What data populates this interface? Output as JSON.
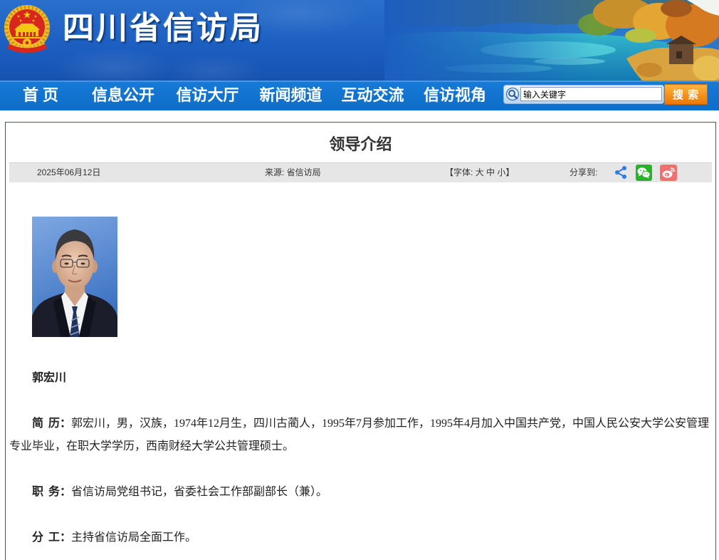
{
  "site": {
    "title": "四川省信访局"
  },
  "nav": {
    "items": [
      {
        "label": "首 页"
      },
      {
        "label": "信息公开"
      },
      {
        "label": "信访大厅"
      },
      {
        "label": "新闻频道"
      },
      {
        "label": "互动交流"
      },
      {
        "label": "信访视角"
      }
    ]
  },
  "search": {
    "value": "输入关键字",
    "button_label": "搜 索",
    "icon": "search-icon"
  },
  "article": {
    "title": "领导介绍",
    "date": "2025年06月12日",
    "source": "来源: 省信访局",
    "font_control": {
      "prefix": "【字体:",
      "sizes": [
        "大",
        "中",
        "小"
      ],
      "suffix": "】"
    },
    "share_label": "分享到:",
    "share_icons": [
      "share-icon",
      "wechat-icon",
      "weibo-icon"
    ],
    "name": "郭宏川",
    "sections": [
      {
        "label": "简 历：",
        "text": "郭宏川，男，汉族，1974年12月生，四川古蔺人，1995年7月参加工作，1995年4月加入中国共产党，中国人民公安大学公安管理专业毕业，在职大学学历，西南财经大学公共管理硕士。"
      },
      {
        "label": "职 务：",
        "text": "省信访局党组书记，省委社会工作部副部长（兼）。"
      },
      {
        "label": "分 工：",
        "text": "主持省信访局全面工作。"
      }
    ]
  },
  "icons": {
    "emblem": "national-emblem-icon",
    "banner": "landscape-banner",
    "photo": "leader-portrait"
  },
  "colors": {
    "header_blue": "#1c5ec0",
    "nav_blue": "#0e6dc9",
    "search_button": "#f5901c",
    "content_border": "#2d5d83",
    "meta_bar": "#e6e6e6",
    "share": "#2e7ce0",
    "wechat": "#28b428",
    "weibo": "#f0706f"
  }
}
